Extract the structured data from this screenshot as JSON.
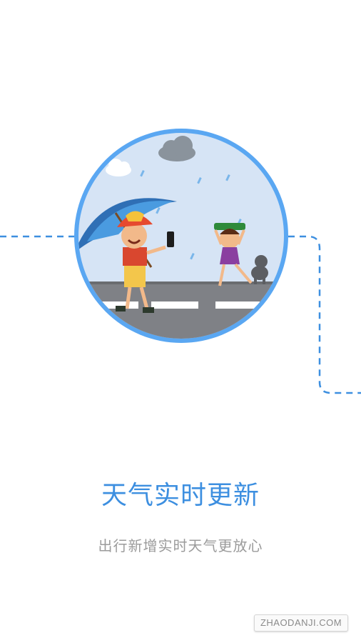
{
  "onboarding": {
    "title": "天气实时更新",
    "subtitle": "出行新增实时天气更放心"
  },
  "watermark": {
    "text": "ZHAODANJI.COM"
  },
  "illustration": {
    "description_icons": [
      "cloud-icon",
      "umbrella-icon",
      "phone-icon",
      "rain-drop-icon",
      "dog-icon"
    ]
  },
  "colors": {
    "accent": "#3d8fe0",
    "ring": "#5aa7f2",
    "sky": "#d6e4f5",
    "road": "#7f8186",
    "subtitle": "#9b9b9b"
  }
}
